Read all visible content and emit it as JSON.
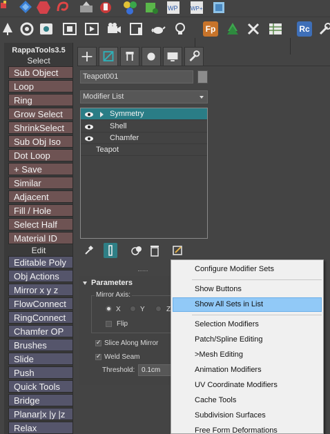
{
  "rappa": {
    "title": "RappaTools3.5",
    "select_header": "Select",
    "edit_header": "Edit",
    "select_buttons": [
      "Sub Object",
      "Loop",
      "Ring",
      "Grow Select",
      "ShrinkSelect",
      "Sub Obj Iso",
      "Dot Loop",
      "+ Save",
      "Similar",
      "Adjacent",
      "Fill / Hole",
      "Select Half",
      "Material ID"
    ],
    "edit_buttons": [
      "Editable Poly",
      "Obj Actions",
      "Mirror  x  y  z",
      "FlowConnect",
      "RingConnect",
      "Chamfer OP",
      "Brushes",
      "Slide",
      "Push",
      "Quick Tools",
      "Bridge",
      "Planar|x |y |z",
      "Relax"
    ]
  },
  "toolbar": {
    "row2_text_icons": [
      "Fp",
      "Rc"
    ]
  },
  "command_panel": {
    "object_name": "Teapot001",
    "modifier_list_label": "Modifier List",
    "stack": [
      {
        "label": "Symmetry",
        "active": true
      },
      {
        "label": "Shell",
        "active": false
      },
      {
        "label": "Chamfer",
        "active": false
      },
      {
        "label": "Teapot",
        "active": false
      }
    ]
  },
  "parameters": {
    "title": "Parameters",
    "mirror_axis_label": "Mirror Axis:",
    "axes": [
      "X",
      "Y",
      "Z"
    ],
    "selected_axis": "X",
    "flip_label": "Flip",
    "slice_label": "Slice Along Mirror",
    "weld_label": "Weld Seam",
    "threshold_label": "Threshold:",
    "threshold_value": "0.1cm"
  },
  "context_menu": {
    "items": [
      "Configure Modifier Sets",
      "Show Buttons",
      "Show All Sets in List",
      "Selection Modifiers",
      "Patch/Spline Editing",
      ">Mesh Editing",
      "Animation Modifiers",
      "UV Coordinate Modifiers",
      "Cache Tools",
      "Subdivision Surfaces",
      "Free Form Deformations"
    ],
    "highlighted_item": "Show All Sets in List"
  },
  "colors": {
    "background": "#444444",
    "select_button": "#6e5353",
    "edit_button": "#55556b",
    "stack_active": "#2a7d86",
    "menu_highlight": "#91c9f7"
  }
}
